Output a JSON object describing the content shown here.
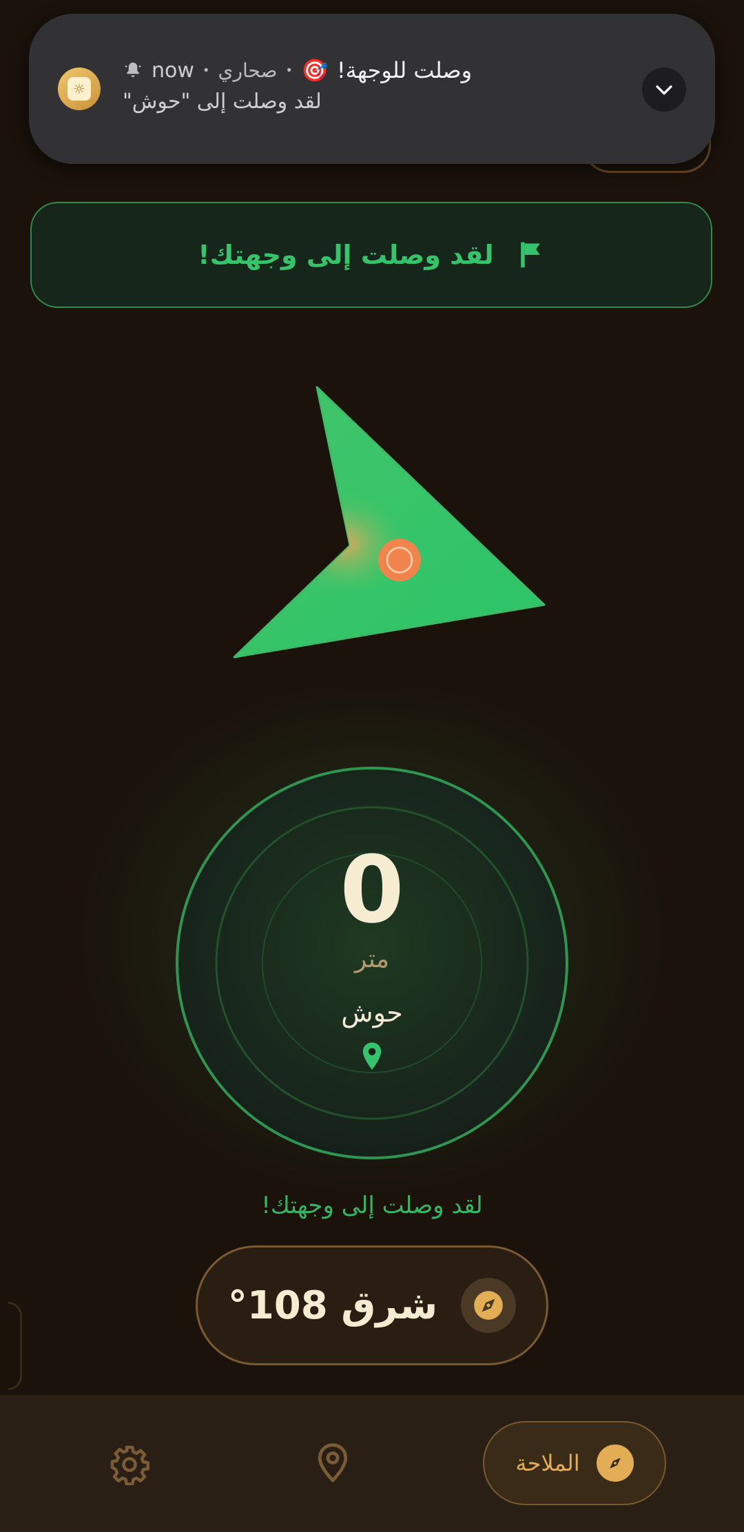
{
  "notification": {
    "title": "وصلت للوجهة!",
    "emoji": "🎯",
    "app_name": "صحاري",
    "time": "now",
    "body": "لقد وصلت إلى \"حوش\"",
    "separator": "•"
  },
  "banner": {
    "text": "لقد وصلت إلى وجهتك!"
  },
  "compass": {
    "distance_value": "0",
    "distance_unit": "متر",
    "destination_name": "حوش"
  },
  "arrival_message": "لقد وصلت إلى وجهتك!",
  "heading": {
    "text": "شرق 108°"
  },
  "bottom_nav": {
    "active_label": "الملاحة"
  },
  "colors": {
    "background": "#1a120b",
    "accent_green": "#35c46c",
    "accent_gold": "#e3ad55",
    "notification_bg": "#323133",
    "location_marker": "#f0844c"
  },
  "icons": {
    "notif_app": "app-logo-icon",
    "bell": "bell-icon",
    "expand": "chevron-down-icon",
    "banner": "flag-icon",
    "destination": "map-pin-icon",
    "heading": "compass-icon",
    "settings": "gear-icon",
    "location": "location-pin-icon",
    "navigation": "compass-icon"
  }
}
